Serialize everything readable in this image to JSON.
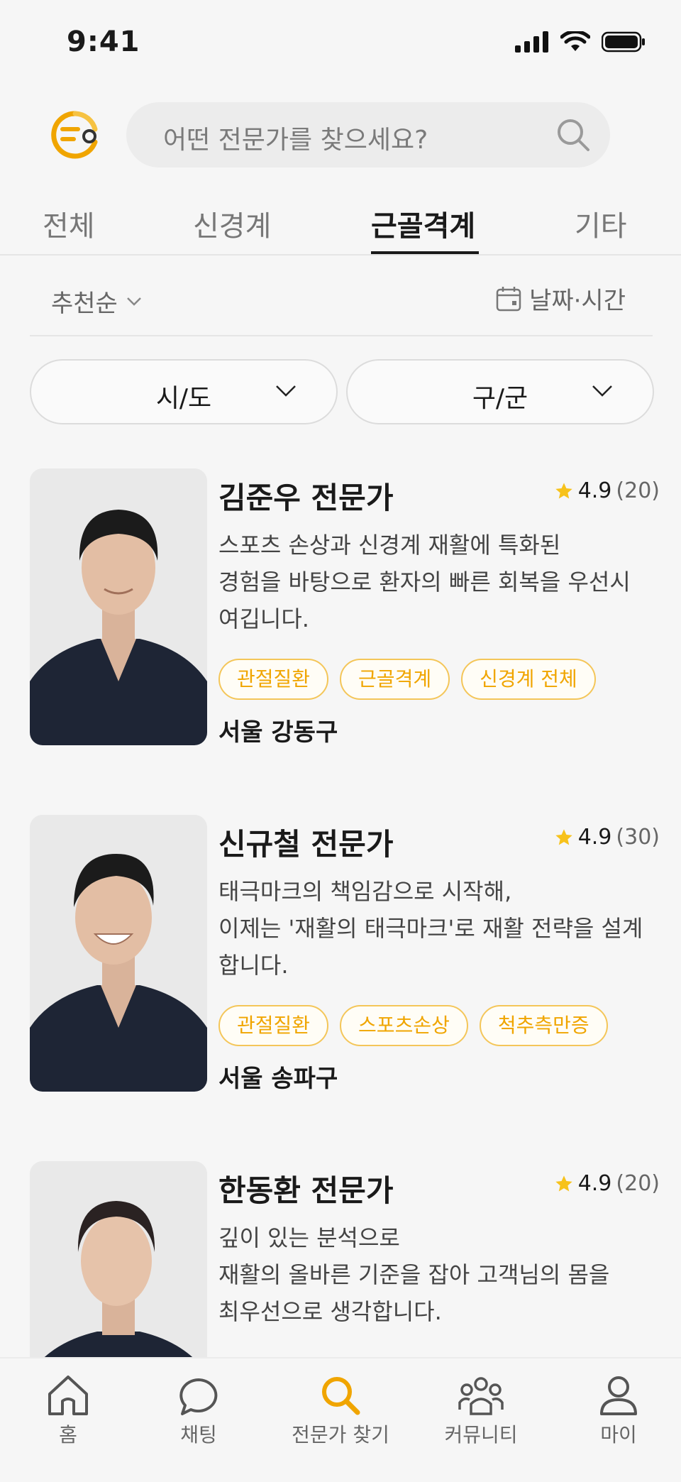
{
  "status_bar": {
    "time": "9:41"
  },
  "search": {
    "placeholder": "어떤 전문가를 찾으세요?"
  },
  "tabs": [
    {
      "label": "전체",
      "active": false
    },
    {
      "label": "신경계",
      "active": false
    },
    {
      "label": "근골격계",
      "active": true
    },
    {
      "label": "기타",
      "active": false
    }
  ],
  "sort": {
    "label": "추천순"
  },
  "date_filter": {
    "label": "날짜·시간"
  },
  "filters": {
    "region": "시/도",
    "district": "구/군"
  },
  "experts": [
    {
      "name": "김준우 전문가",
      "rating": "4.9",
      "reviews": "(20)",
      "desc_lines": [
        "스포츠 손상과 신경계 재활에 특화된",
        "경험을 바탕으로 환자의 빠른 회복을 우선시",
        "여깁니다."
      ],
      "tags": [
        "관절질환",
        "근골격계",
        "신경계 전체"
      ],
      "location": "서울 강동구"
    },
    {
      "name": "신규철 전문가",
      "rating": "4.9",
      "reviews": "(30)",
      "desc_lines": [
        "태극마크의 책임감으로 시작해,",
        "이제는 '재활의 태극마크'로 재활 전략을 설계",
        "합니다."
      ],
      "tags": [
        "관절질환",
        "스포츠손상",
        "척추측만증"
      ],
      "location": "서울 송파구"
    },
    {
      "name": "한동환 전문가",
      "rating": "4.9",
      "reviews": "(20)",
      "desc_lines": [
        "깊이 있는 분석으로",
        "재활의 올바른 기준을 잡아 고객님의 몸을",
        "최우선으로 생각합니다."
      ],
      "tags": [],
      "location": ""
    }
  ],
  "nav": [
    {
      "label": "홈",
      "icon": "home-icon",
      "active": false
    },
    {
      "label": "채팅",
      "icon": "chat-icon",
      "active": false
    },
    {
      "label": "전문가 찾기",
      "icon": "search-icon",
      "active": true
    },
    {
      "label": "커뮤니티",
      "icon": "community-icon",
      "active": false
    },
    {
      "label": "마이",
      "icon": "user-icon",
      "active": false
    }
  ],
  "colors": {
    "accent": "#f0a500",
    "tag_border": "#f4c659",
    "background": "#f6f6f6"
  }
}
